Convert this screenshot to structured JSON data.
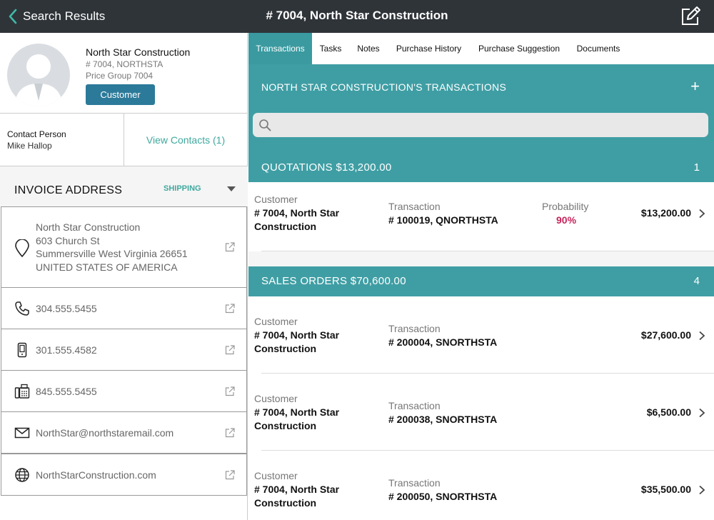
{
  "header": {
    "back_label": "Search Results",
    "title": "# 7004, North Star Construction"
  },
  "profile": {
    "name": "North Star Construction",
    "code": "# 7004, NORTHSTA",
    "price_group": "Price Group 7004",
    "type_button": "Customer"
  },
  "contact": {
    "label": "Contact Person",
    "name": "Mike Hallop",
    "view_contacts": "View Contacts (1)"
  },
  "address_section": {
    "title": "INVOICE ADDRESS",
    "toggle": "SHIPPING",
    "address_lines": [
      "North Star Construction",
      "603 Church St",
      "Summersville West Virginia 26651",
      "UNITED STATES OF AMERICA"
    ],
    "phone": "304.555.5455",
    "mobile": "301.555.4582",
    "fax": "845.555.5455",
    "email": "NorthStar@northstaremail.com",
    "website": "NorthStarConstruction.com"
  },
  "tabs": [
    {
      "label": "Transactions",
      "active": true
    },
    {
      "label": "Tasks",
      "active": false
    },
    {
      "label": "Notes",
      "active": false
    },
    {
      "label": "Purchase History",
      "active": false
    },
    {
      "label": "Purchase Suggestion",
      "active": false
    },
    {
      "label": "Documents",
      "active": false
    }
  ],
  "transactions": {
    "title": "NORTH STAR CONSTRUCTION'S TRANSACTIONS",
    "add_symbol": "+",
    "search_placeholder": "",
    "column_labels": {
      "customer": "Customer",
      "transaction": "Transaction",
      "probability": "Probability"
    },
    "quotations": {
      "title": "QUOTATIONS $13,200.00",
      "count": "1",
      "rows": [
        {
          "customer_line1": "# 7004, North Star",
          "customer_line2": "Construction",
          "transaction": "# 100019, QNORTHSTA",
          "probability": "90%",
          "amount": "$13,200.00"
        }
      ]
    },
    "sales_orders": {
      "title": "SALES ORDERS $70,600.00",
      "count": "4",
      "rows": [
        {
          "customer_line1": "# 7004, North Star",
          "customer_line2": "Construction",
          "transaction": "# 200004, SNORTHSTA",
          "amount": "$27,600.00"
        },
        {
          "customer_line1": "# 7004, North Star",
          "customer_line2": "Construction",
          "transaction": "# 200038, SNORTHSTA",
          "amount": "$6,500.00"
        },
        {
          "customer_line1": "# 7004, North Star",
          "customer_line2": "Construction",
          "transaction": "# 200050, SNORTHSTA",
          "amount": "$35,500.00"
        }
      ]
    }
  },
  "colors": {
    "topbar": "#2f3439",
    "teal": "#3f9ea4",
    "button_blue": "#2c7a99",
    "link_teal": "#3fa99e",
    "probability_red": "#c7245a"
  }
}
